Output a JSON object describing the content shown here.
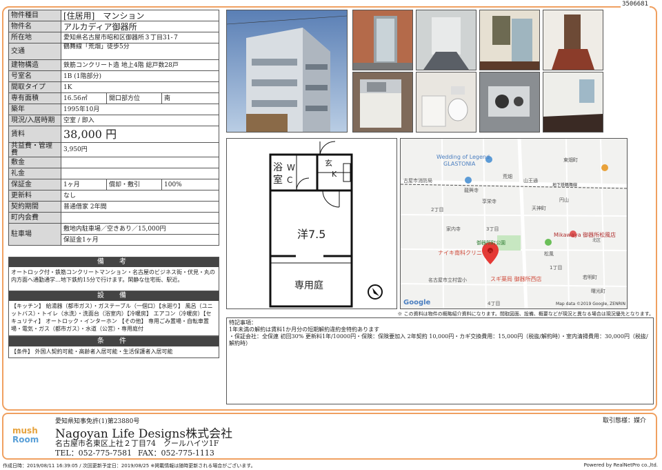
{
  "doc_number": "3506681",
  "rows": [
    {
      "label": "物件種目",
      "value": "[住居用]　マンション"
    },
    {
      "label": "物件名",
      "value": "アルカディア御器所"
    },
    {
      "label": "所在地",
      "value": "愛知県名古屋市昭和区御器所３丁目31-７"
    },
    {
      "label": "交通",
      "value": "鶴舞線「荒畑」徒歩5分"
    },
    {
      "label": "建物構造",
      "value": "鉄筋コンクリート造 地上4階 総戸数28戸"
    },
    {
      "label": "号室名",
      "value": "1B (1階部分)"
    },
    {
      "label": "間取タイプ",
      "value": "1K"
    },
    {
      "label": "専有面積",
      "value": "16.56㎡",
      "label2": "開口部方位",
      "value2": "南"
    },
    {
      "label": "築年",
      "value": "1995年10月"
    },
    {
      "label": "現況/入居時期",
      "value": "空室 / 即入"
    },
    {
      "label": "賃料",
      "value": "38,000 円"
    },
    {
      "label": "共益費・管理費",
      "value": "3,950円"
    },
    {
      "label": "敷金",
      "value": ""
    },
    {
      "label": "礼金",
      "value": ""
    },
    {
      "label": "保証金",
      "value": "1ヶ月",
      "label2": "償却・敷引",
      "value2": "100%"
    },
    {
      "label": "更新料",
      "value": "なし"
    },
    {
      "label": "契約期間",
      "value": "普通借家 2年間"
    },
    {
      "label": "町内会費",
      "value": ""
    },
    {
      "label": "駐車場",
      "value": "敷地内駐車場／空きあり／15,000円",
      "value_b": "保証金1ヶ月"
    }
  ],
  "remarks": {
    "title": "備　考",
    "text": "オートロック付・鉄筋コンクリートマンション・名古屋のビジネス街・伏見・丸の内方面へ通勤通学…地下鉄約15分で行けます。閑静な住宅街、駅近。"
  },
  "equipment": {
    "title": "設　備",
    "text": "【キッチン】 給湯器（都市ガス）・ガステーブル（一個口）【水廻り】 風呂（ユニットバス）・トイレ（水洗）・洗面台（浴室内）【冷暖房】 エアコン（冷暖房）【セキュリティ】 オートロック・インターホン 【その他】 専用ごみ置場・自転車置場・電気・ガス（都市ガス）・水道（公営）・専用庭付"
  },
  "conditions": {
    "title": "条　件",
    "text": "【条件】 外国人契約可能・高齢者入居可能・生活保護者入居可能"
  },
  "plan": {
    "bath": "浴室",
    "wc": "W C",
    "entrance": "玄",
    "kitchen": "K",
    "room": "洋7.5",
    "garden": "専用庭"
  },
  "map": {
    "labels": [
      "Wedding of Legend",
      "GLASTONIA",
      "古屋市消防局",
      "荒畑",
      "山王通",
      "地下鉄鶴舞線",
      "龍興寺",
      "享栄寺",
      "円山",
      "天神町",
      "家内寺",
      "3丁目",
      "御器所町公園",
      "Mikawaya 御器所松風店",
      "ナイキ南科クリニック",
      "スギ薬局 御器所西店",
      "名古屋市立村雲小",
      "松風",
      "若明町",
      "曙光町",
      "2丁目",
      "1丁目",
      "4丁目",
      "北区",
      "東畑町",
      "Google",
      "Map data ©2019 Google, ZENRIN"
    ]
  },
  "photo_note": "※ この資料は物件の概略紹介資料になります。間取図面、設備、概要などが現況と異なる場合は現況優先となります。",
  "special": {
    "title": "特記事項：",
    "lines": [
      "1年未満の解約は賃料1か月分の短期解約違約金特約あります",
      "・保証会社：全保連 初回30% 更新料1年/10000円・保険：保険要加入 2年契約 10,000円・カギ交換費用：15,000円（税抜/解約時）・室内清掃費用：30,000円（税抜/解約時）"
    ]
  },
  "company": {
    "license": "愛知県知事免許(1)第23880号",
    "name": "Nagoyan Life Designs株式会社",
    "address": "名古屋市名東区上社２丁目74　クールハイツ1F",
    "tel": "TEL：052-775-7581",
    "fax": "FAX：052-775-1113",
    "logo_l1": "mush",
    "logo_l2": "Room"
  },
  "transaction": "取引態様：媒介",
  "bottom_left": "作成日時：2019/08/11 16:39:05 / 次回更新予定日：2019/08/25 ※掲載情報は随時更新される場合がございます。",
  "bottom_right": "Powered by RealNetPro co.,ltd."
}
